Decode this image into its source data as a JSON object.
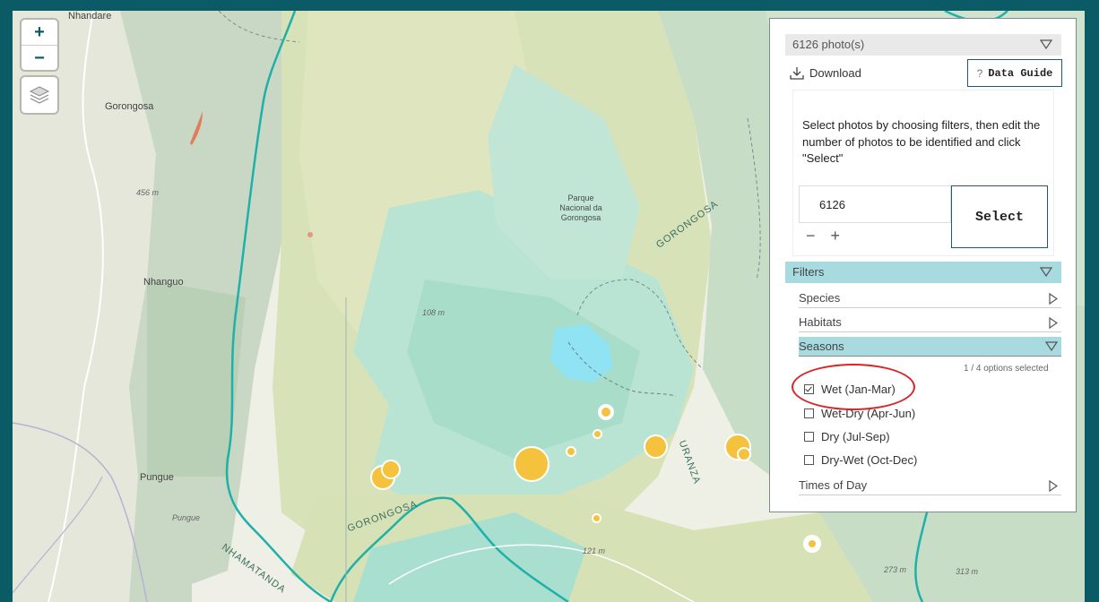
{
  "map": {
    "zoom_in": "+",
    "zoom_out": "−",
    "layers_icon": "layers-icon",
    "labels": {
      "nhandare": "Nhandare",
      "gorongosa_town": "Gorongosa",
      "elev_456": "456 m",
      "nhanguo": "Nhanguo",
      "pungue_town": "Pungue",
      "pungue_river": "Pungue",
      "park": "Parque\nNacional da\nGorongosa",
      "elev_108": "108 m",
      "river_gorongosa_ne": "GORONGOSA",
      "river_gorongosa_s": "GORONGOSA",
      "river_nhamatanda": "NHAMATANDA",
      "river_urema": "URANZA",
      "elev_121": "121 m",
      "elev_273": "273 m",
      "elev_313": "313 m"
    }
  },
  "panel": {
    "photo_count_label": "6126 photo(s)",
    "download_label": "Download",
    "data_guide_label": "Data Guide",
    "data_guide_q": "?",
    "instructions": "Select photos by choosing filters, then edit the number of photos to be identified and click \"Select\"",
    "number_value": "6126",
    "minus": "−",
    "plus": "+",
    "select_label": "Select",
    "filters_label": "Filters",
    "species_label": "Species",
    "habitats_label": "Habitats",
    "seasons_label": "Seasons",
    "options_selected": "1 / 4 options selected",
    "season_options": [
      {
        "label": "Wet (Jan-Mar)",
        "checked": true
      },
      {
        "label": "Wet-Dry (Apr-Jun)",
        "checked": false
      },
      {
        "label": "Dry (Jul-Sep)",
        "checked": false
      },
      {
        "label": "Dry-Wet (Oct-Dec)",
        "checked": false
      }
    ],
    "times_of_day_label": "Times of Day"
  },
  "colors": {
    "frame": "#0b5b66",
    "accent_bar": "#a8dbe0",
    "marker": "#f4c23c",
    "annotation_circle": "#d9252a"
  }
}
